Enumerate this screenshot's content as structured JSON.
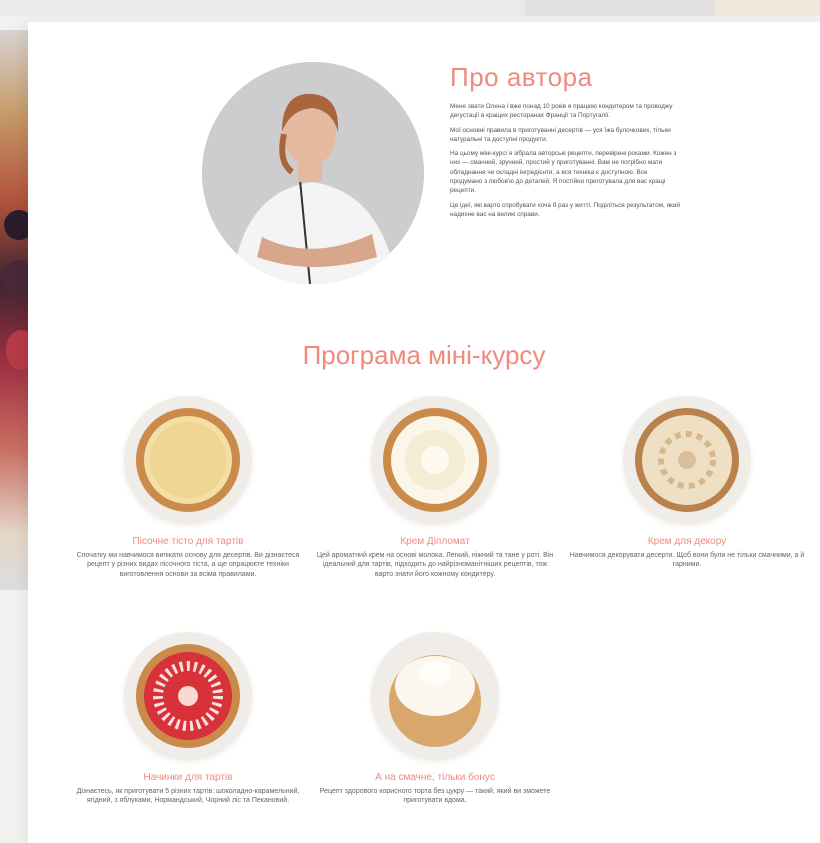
{
  "about": {
    "title": "Про автора",
    "paragraphs": [
      "Мене звати Олена і вже понад 10 років я працюю кондитером та проводжу дегустації в кращих ресторанах Франції та Португалії.",
      "Мої основні правила в приготуванні десертів — уся їжа булочкових, тільки натуральні та доступні продукти.",
      "На цьому міні-курсі я зібрала авторські рецепти, перевірені роками. Кожен з них — смачний, зручний, простий у приготуванні. Вам не потрібно мати обладнання чи складні інгредієнти, а вся техніка є доступною. Все продумано з любов'ю до деталей. Я постійно приготувала для вас кращі рецепти.",
      "Це ідеї, які варто спробувати хоча б раз у житті. Поділіться результатом, який надихне вас на великі справи."
    ]
  },
  "program": {
    "title": "Програма міні-курсу",
    "items": [
      {
        "title": "Пісочне тісто для тартів",
        "desc": "Спочатку ми навчимося випікати основу для десертів. Ви дізнаєтеся рецепт у різних видах пісочного тіста, а ще опрацюєте техніки виготовлення основи за всіма правилами."
      },
      {
        "title": "Крем Діпломат",
        "desc": "Цей ароматний крем на основі молока. Легкий, ніжний та тане у роті. Він ідеальний для тартів, підходить до найрізноманітніших рецептів, тож варто знати його кожному кондитеру."
      },
      {
        "title": "Крем для декору",
        "desc": "Навчимося декорувати десерти. Щоб вони були не тільки смачними, а й гарними."
      },
      {
        "title": "Начинки для тартів",
        "desc": "Дізнаєтесь, як приготувати 5 різних тартів: шоколадно-карамельний, ягідний, з яблуками, Нормандський, Чорний ліс та Пекановий."
      },
      {
        "title": "А на смачне, тільки бонус",
        "desc": "Рецепт здорового корисного торта без цукру — такий, який ви зможете приготувати вдома."
      }
    ]
  },
  "colors": {
    "accent": "#ef8a7d",
    "text": "#555555",
    "card": "#ffffff"
  }
}
